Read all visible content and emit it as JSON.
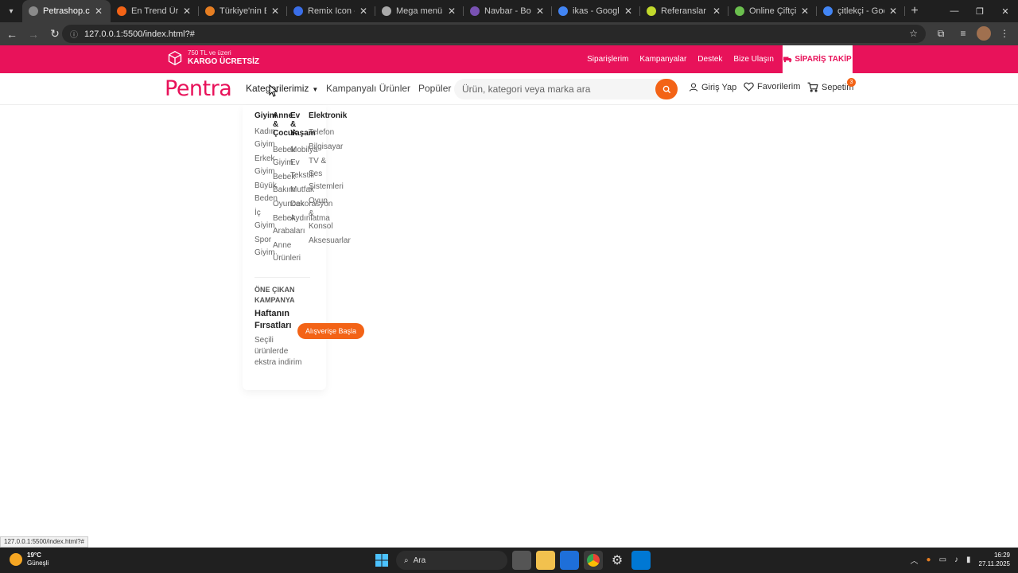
{
  "browser": {
    "tabs": [
      {
        "title": "Petrashop.com | A",
        "fav": "#8a8a8a",
        "active": true
      },
      {
        "title": "En Trend Ürünler",
        "fav": "#f36316",
        "active": false
      },
      {
        "title": "Türkiye'nin En Ço",
        "fav": "#e67e22",
        "active": false
      },
      {
        "title": "Remix Icon - Ope",
        "fav": "#3a6ee8",
        "active": false
      },
      {
        "title": "Mega menü tasar",
        "fav": "#aaaaaa",
        "active": false
      },
      {
        "title": "Navbar - Bootstra",
        "fav": "#7952b3",
        "active": false
      },
      {
        "title": "ikas - Google'da A",
        "fav": "#4285f4",
        "active": false
      },
      {
        "title": "Referanslar - ikas",
        "fav": "#c2d92c",
        "active": false
      },
      {
        "title": "Online Çiftçi | Taz",
        "fav": "#6bbf4e",
        "active": false
      },
      {
        "title": "çitlekçi - Google",
        "fav": "#4285f4",
        "active": false
      }
    ],
    "url": "127.0.0.1:5500/index.html?#",
    "status_url": "127.0.0.1:5500/index.html?#"
  },
  "topbar": {
    "promo_small": "750 TL ve üzeri",
    "promo_big": "KARGO ÜCRETSİZ",
    "links": [
      "Siparişlerim",
      "Kampanyalar",
      "Destek",
      "Bize Ulaşın"
    ],
    "track_label": "SİPARİŞ TAKİP"
  },
  "nav": {
    "logo": "Pentra",
    "categories": "Kategorilerimiz",
    "campaign_products": "Kampanyalı Ürünler",
    "popular": "Popüler",
    "search_placeholder": "Ürün, kategori veya marka ara",
    "login": "Giriş Yap",
    "favorites": "Favorilerim",
    "cart": "Sepetim",
    "cart_count": "3"
  },
  "mega_menu": {
    "columns": [
      {
        "title": "Giyim",
        "items": [
          "Kadın Giyim",
          "Erkek Giyim",
          "Büyük Beden",
          "İç Giyim",
          "Spor Giyim"
        ]
      },
      {
        "title": "Anne & Çocuk",
        "items": [
          "Bebek Giyim",
          "Bebek Bakım",
          "Oyuncak",
          "Bebek Arabaları",
          "Anne Ürünleri"
        ]
      },
      {
        "title": "Ev & Yaşam",
        "items": [
          "Mobilya",
          "Ev Tekstili",
          "Mutfak",
          "Dekorasyon",
          "Aydınlatma"
        ]
      },
      {
        "title": "Elektronik",
        "items": [
          "Telefon",
          "Bilgisayar",
          "TV & Ses Sistemleri",
          "Oyun & Konsol",
          "Aksesuarlar"
        ]
      }
    ],
    "featured": {
      "kicker": "ÖNE ÇIKAN KAMPANYA",
      "title": "Haftanın Fırsatları",
      "desc": "Seçili ürünlerde ekstra indirim",
      "button": "Alışverişe Başla"
    }
  },
  "taskbar": {
    "temp": "19°C",
    "weather": "Güneşli",
    "search": "Ara",
    "time": "16:29",
    "date": "27.11.2025"
  }
}
